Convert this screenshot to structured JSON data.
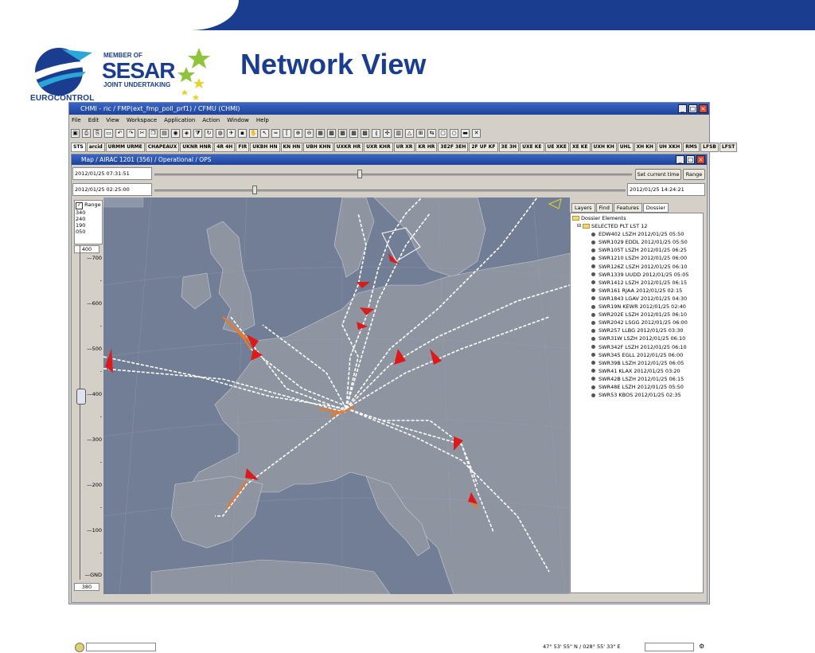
{
  "slide": {
    "title": "Network View",
    "eurocontrol_label": "EUROCONTROL",
    "sesar": {
      "line1": "MEMBER OF",
      "line2": "SESAR",
      "line3": "JOINT UNDERTAKING"
    }
  },
  "window": {
    "title": "CHMI - ric / FMP(ext_fmp_poll_prf1) / CFMU (CHMI)",
    "menu": [
      "File",
      "Edit",
      "View",
      "Workspace",
      "Application",
      "Action",
      "Window",
      "Help"
    ]
  },
  "tabs": [
    "STS",
    "arcid",
    "URMM URME",
    "CHAPEAUX",
    "UKNR HNR",
    "4R 4H",
    "FIR",
    "UKBH HN",
    "KN HN",
    "UBH KHN",
    "UXKR HR",
    "UXR KHR",
    "UR XR",
    "KR HR",
    "3E2F 3EH",
    "2F UF KF",
    "3E 3H",
    "UXE KE",
    "UE XKE",
    "XE KE",
    "UXH KH",
    "UHL",
    "XH KH",
    "UH XKH",
    "RMS",
    "LFSB",
    "LFST"
  ],
  "active_tab": "STS",
  "map_window": {
    "title": "Map / AIRAC 1201 (356) / Operational / OPS",
    "time_top": "2012/01/25 07:31:51",
    "time_bottom_left": "2012/01/25 02:25:00",
    "time_bottom_right": "2012/01/25 14:24:21",
    "set_time_label": "Set current time",
    "range_label": "Range",
    "slider_top_fraction": 0.43,
    "slider_bottom_fraction": 0.21
  },
  "left_panel": {
    "range_checkbox_label": "Range",
    "range_values": [
      "340",
      "240",
      "190",
      "050"
    ],
    "upper_value": "400",
    "lower_value": "380",
    "altitude_labels": [
      "—700",
      "-",
      "—600",
      "-",
      "—500",
      "-",
      "—400",
      "-",
      "—300",
      "-",
      "—200",
      "-",
      "—100",
      "-",
      "—GND"
    ]
  },
  "right_panel": {
    "tabs": [
      "Layers",
      "Find",
      "Features",
      "Dossier"
    ],
    "active_tab": "Dossier",
    "root": "Dossier Elements",
    "group": "SELECTED PLT LST 12",
    "flights": [
      "EDW402 LSZH 2012/01/25 05:50",
      "SWR1029 EDDL 2012/01/25 05:50",
      "SWR105T LSZH 2012/01/25 06:25",
      "SWR1210 LSZH 2012/01/25 06:00",
      "SWR126Z LSZH 2012/01/25 06:10",
      "SWR1339 UUDD 2012/01/25 05:05",
      "SWR1412 LSZH 2012/01/25 06:15",
      "SWR161 RJAA 2012/01/25 02:15",
      "SWR1843 LGAV 2012/01/25 04:30",
      "SWR19N KEWR 2012/01/25 02:40",
      "SWR202E LSZH 2012/01/25 06:10",
      "SWR2042 LSGG 2012/01/25 06:00",
      "SWR257 LLBG 2012/01/25 03:30",
      "SWR31W LSZH 2012/01/25 06:10",
      "SWR342F LSZH 2012/01/25 06:10",
      "SWR345 EGLL 2012/01/25 06:00",
      "SWR39B LSZH 2012/01/25 06:05",
      "SWR41 KLAX 2012/01/25 03:20",
      "SWR42B LSZH 2012/01/25 06:15",
      "SWR48E LSZH 2012/01/25 05:50",
      "SWR53 KBOS 2012/01/25 02:35"
    ]
  },
  "status": {
    "coordinates": "47° 53' 55\" N / 028° 55' 33\" E"
  },
  "colors": {
    "brand_blue": "#1a3d8f",
    "map_sea": "#727e96",
    "map_land": "#8f95a0",
    "track_white": "#ffffff",
    "track_orange": "#e8782c",
    "arrow_red": "#dd1a1a"
  }
}
